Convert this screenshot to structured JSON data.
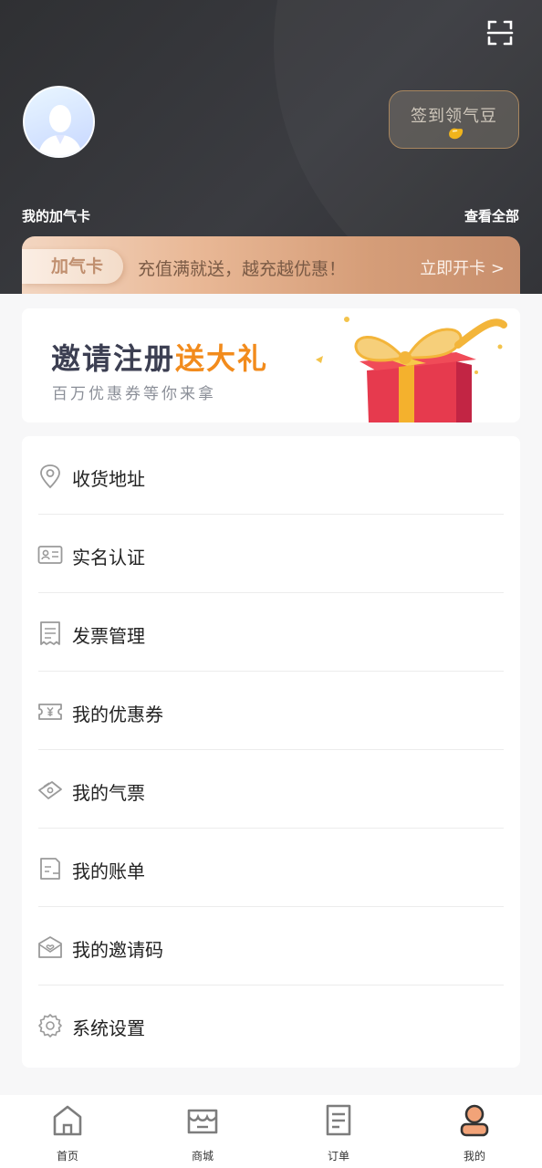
{
  "header": {
    "checkin_label": "签到领气豆",
    "card_section_title": "我的加气卡",
    "view_all_label": "查看全部"
  },
  "gas_card": {
    "badge": "加气卡",
    "promo": "充值满就送，越充越优惠！",
    "open_label": "立即开卡 >"
  },
  "banner": {
    "title_main": "邀请注册",
    "title_highlight": "送大礼",
    "subtitle": "百万优惠券等你来拿"
  },
  "menu": {
    "items": [
      {
        "label": "收货地址",
        "icon": "location-icon"
      },
      {
        "label": "实名认证",
        "icon": "id-card-icon"
      },
      {
        "label": "发票管理",
        "icon": "invoice-icon"
      },
      {
        "label": "我的优惠券",
        "icon": "coupon-icon"
      },
      {
        "label": "我的气票",
        "icon": "ticket-icon"
      },
      {
        "label": "我的账单",
        "icon": "bill-icon"
      },
      {
        "label": "我的邀请码",
        "icon": "invite-code-icon"
      },
      {
        "label": "系统设置",
        "icon": "settings-icon"
      }
    ]
  },
  "tabbar": {
    "items": [
      {
        "label": "首页",
        "icon": "home-icon"
      },
      {
        "label": "商城",
        "icon": "shop-icon"
      },
      {
        "label": "订单",
        "icon": "order-icon"
      },
      {
        "label": "我的",
        "icon": "profile-icon",
        "active": true
      }
    ],
    "accent": "#f0a57a"
  }
}
